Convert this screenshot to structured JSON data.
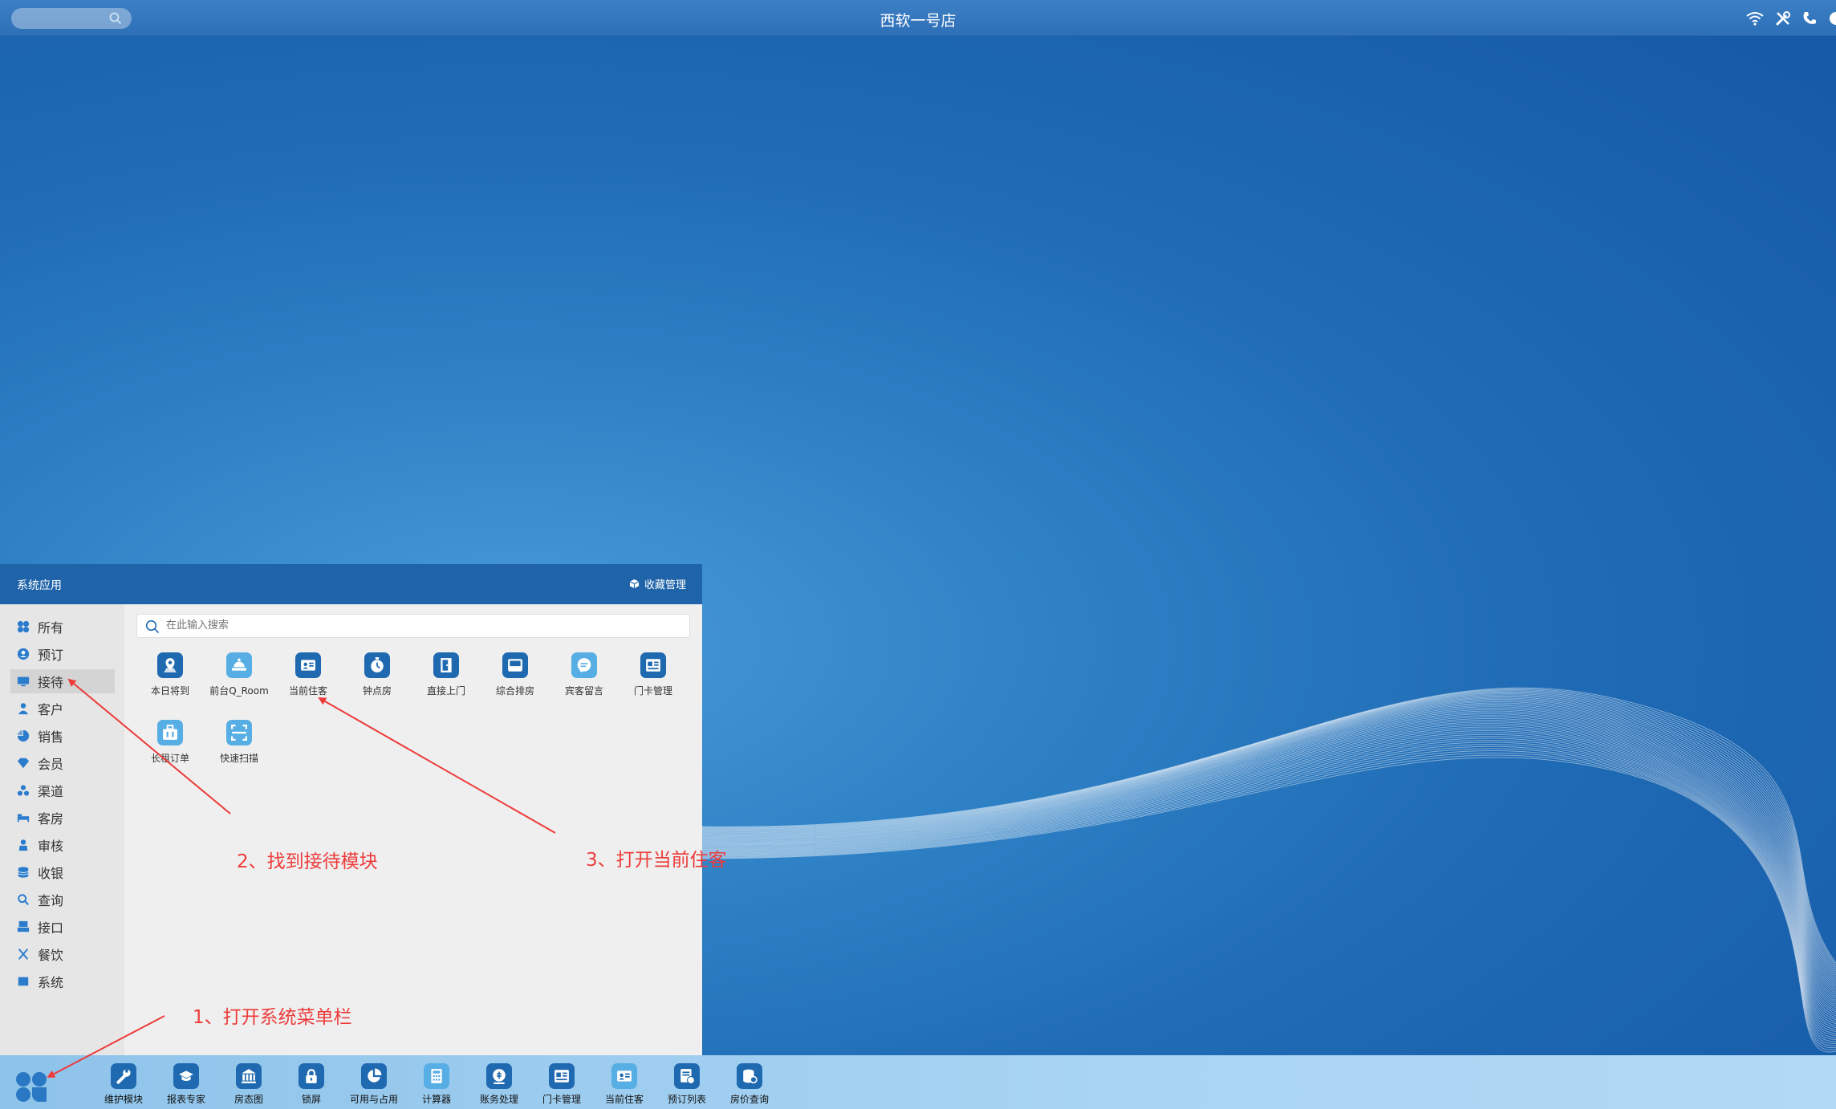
{
  "topbar": {
    "store_name": "西软一号店"
  },
  "start_menu": {
    "title": "系统应用",
    "fav_manage_label": "收藏管理",
    "search_placeholder": "在此输入搜索",
    "categories": [
      {
        "label": "所有",
        "icon": "grid-icon"
      },
      {
        "label": "预订",
        "icon": "user-circle-icon"
      },
      {
        "label": "接待",
        "icon": "monitor-icon",
        "active": true
      },
      {
        "label": "客户",
        "icon": "person-icon"
      },
      {
        "label": "销售",
        "icon": "pie-icon"
      },
      {
        "label": "会员",
        "icon": "diamond-icon"
      },
      {
        "label": "渠道",
        "icon": "channel-icon"
      },
      {
        "label": "客房",
        "icon": "bed-icon"
      },
      {
        "label": "审核",
        "icon": "auditor-icon"
      },
      {
        "label": "收银",
        "icon": "coins-icon"
      },
      {
        "label": "查询",
        "icon": "search-icon"
      },
      {
        "label": "接口",
        "icon": "interface-icon"
      },
      {
        "label": "餐饮",
        "icon": "utensils-icon"
      },
      {
        "label": "系统",
        "icon": "system-icon"
      }
    ],
    "apps": [
      {
        "label": "本日将到",
        "icon": "map-pin-icon",
        "tone": "dark"
      },
      {
        "label": "前台Q_Room",
        "icon": "reception-bell-icon",
        "tone": "light"
      },
      {
        "label": "当前住客",
        "icon": "id-card-icon",
        "tone": "dark"
      },
      {
        "label": "钟点房",
        "icon": "stopwatch-icon",
        "tone": "dark"
      },
      {
        "label": "直接上门",
        "icon": "door-icon",
        "tone": "dark"
      },
      {
        "label": "综合排房",
        "icon": "room-arrange-icon",
        "tone": "dark"
      },
      {
        "label": "宾客留言",
        "icon": "message-icon",
        "tone": "light"
      },
      {
        "label": "门卡管理",
        "icon": "key-card-icon",
        "tone": "dark"
      },
      {
        "label": "长租订单",
        "icon": "suitcase-icon",
        "tone": "light"
      },
      {
        "label": "快速扫描",
        "icon": "scan-icon",
        "tone": "light"
      }
    ]
  },
  "taskbar": {
    "apps": [
      {
        "label": "维护模块",
        "icon": "wrench-icon",
        "tone": "dark"
      },
      {
        "label": "报表专家",
        "icon": "graduation-cap-icon",
        "tone": "dark"
      },
      {
        "label": "房态图",
        "icon": "bank-icon",
        "tone": "dark"
      },
      {
        "label": "锁屏",
        "icon": "lock-icon",
        "tone": "dark"
      },
      {
        "label": "可用与占用",
        "icon": "pie-chart-icon",
        "tone": "dark"
      },
      {
        "label": "计算器",
        "icon": "calculator-icon",
        "tone": "light"
      },
      {
        "label": "账务处理",
        "icon": "finance-icon",
        "tone": "dark"
      },
      {
        "label": "门卡管理",
        "icon": "key-card-icon",
        "tone": "dark"
      },
      {
        "label": "当前住客",
        "icon": "id-card-icon",
        "tone": "light"
      },
      {
        "label": "预订列表",
        "icon": "booking-list-icon",
        "tone": "dark"
      },
      {
        "label": "房价查询",
        "icon": "price-query-icon",
        "tone": "dark"
      }
    ]
  },
  "annotations": [
    {
      "text": "1、打开系统菜单栏"
    },
    {
      "text": "2、找到接待模块"
    },
    {
      "text": "3、打开当前住客"
    }
  ],
  "colors": {
    "accent": "#1f63a9",
    "annotation": "#ee3b3b",
    "tile_dark": "#1f69b0",
    "tile_light": "#57aee4"
  }
}
